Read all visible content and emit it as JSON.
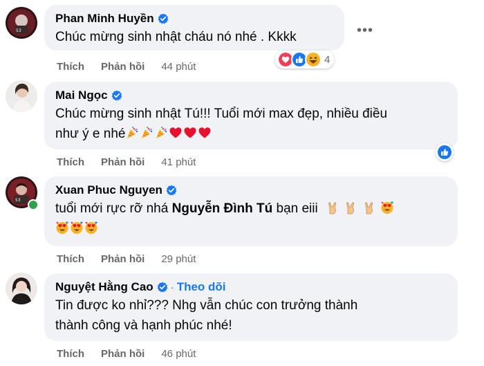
{
  "comments": [
    {
      "name": "Phan Minh Huyền",
      "text": "Chúc mừng sinh nhật cháu nó nhé . Kkkk",
      "like_label": "Thích",
      "reply_label": "Phản hồi",
      "time": "44 phút",
      "reaction_count": "4",
      "reactions": [
        "love-icon",
        "like-icon",
        "haha-icon"
      ]
    },
    {
      "name": "Mai Ngọc",
      "line1": "Chúc mừng sinh nhật Tú!!! Tuổi mới max đẹp, nhiều điều",
      "line2": "như ý e nhé",
      "like_label": "Thích",
      "reply_label": "Phản hồi",
      "time": "41 phút"
    },
    {
      "name": "Xuan Phuc Nguyen",
      "text_before": "tuổi mới rực rỡ nhá ",
      "mention": "Nguyễn Đình Tú",
      "text_after": " bạn eiii",
      "like_label": "Thích",
      "reply_label": "Phản hồi",
      "time": "29 phút"
    },
    {
      "name": "Nguyệt Hằng Cao",
      "separator": "·",
      "follow_label": "Theo dõi",
      "line1": "Tin được ko nhỉ??? Nhg vẫn chúc con trưởng thành",
      "line2": "thành công và hạnh phúc nhé!",
      "like_label": "Thích",
      "reply_label": "Phản hồi",
      "time": "46 phút"
    }
  ],
  "colors": {
    "bubble": "#f0f2f5",
    "verified": "#1877f2",
    "meta": "#65676b",
    "love": "#f33e58",
    "like": "#1877f2",
    "haha": "#f7b125",
    "online": "#31a24c"
  }
}
